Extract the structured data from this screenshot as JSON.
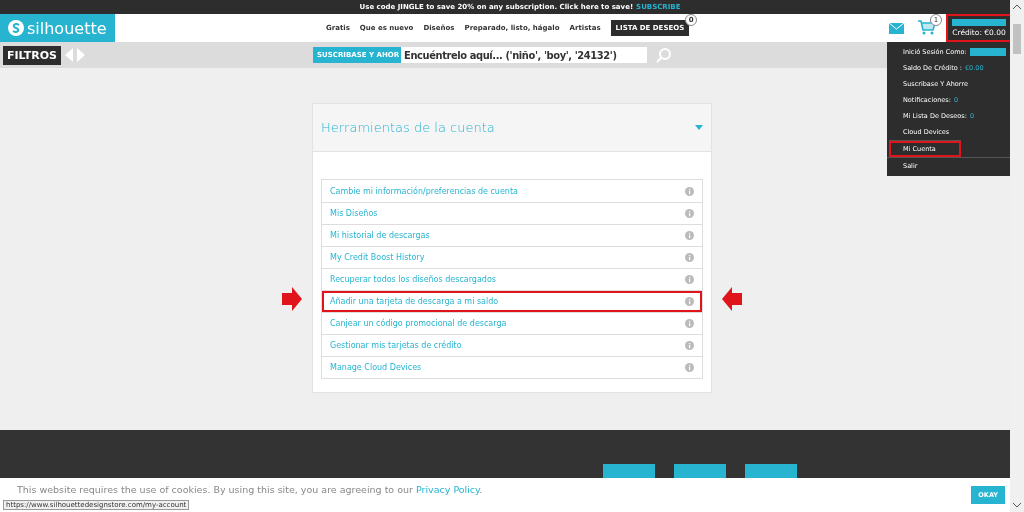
{
  "promo_banner": {
    "text": "Use code JINGLE to save 20% on any subscription. Click here to save!",
    "link": "SUBSCRIBE"
  },
  "header": {
    "logo": "silhouette",
    "nav": [
      "Gratis",
      "Que es nuevo",
      "Diseños",
      "Preparado, listo, hágalo",
      "Artistas"
    ],
    "wishlist": {
      "label": "LISTA DE DESEOS",
      "count": "0"
    },
    "cart_count": "1",
    "credit": {
      "label": "Crédito: €0.00",
      "highlighted": true
    }
  },
  "filter_bar": {
    "filters_label": "FILTROS",
    "subscribe_button": "SUSCRIBASE Y AHOR",
    "search": {
      "placeholder": "Encuéntrelo aquí... ('niño', 'boy', '24132')"
    }
  },
  "account_menu": {
    "items": [
      {
        "label": "Inició Sesión Como:",
        "kind": "redacted",
        "highlighted": false
      },
      {
        "label": "Saldo De Crédito :",
        "value": "€0.00",
        "kind": "boost",
        "highlighted": false
      },
      {
        "label": "Suscribase Y Ahorre",
        "kind": "plain",
        "highlighted": false
      },
      {
        "label": "Notificaciones:",
        "value": "0",
        "kind": "value",
        "highlighted": false
      },
      {
        "label": "Mi Lista De Deseos:",
        "value": "0",
        "kind": "value",
        "highlighted": false
      },
      {
        "label": "Cloud Devices",
        "kind": "plain",
        "highlighted": false
      },
      {
        "label": "Mi Cuenta",
        "kind": "divided",
        "highlighted": true
      },
      {
        "label": "Salir",
        "kind": "divided",
        "highlighted": false
      }
    ]
  },
  "account_tools": {
    "title": "Herramientas de la cuenta",
    "expanded": true,
    "items": [
      {
        "label": "Cambie mi información/preferencias de cuenta",
        "highlighted": false
      },
      {
        "label": "Mis Diseños",
        "highlighted": false
      },
      {
        "label": "Mi historial de descargas",
        "highlighted": false
      },
      {
        "label": "My Credit Boost History",
        "highlighted": false
      },
      {
        "label": "Recuperar todos los diseños descargados",
        "highlighted": false
      },
      {
        "label": "Añadir una tarjeta de descarga a mi saldo",
        "highlighted": true
      },
      {
        "label": "Canjear un código promocional de descarga",
        "highlighted": false
      },
      {
        "label": "Gestionar mis tarjetas de crédito",
        "highlighted": false
      },
      {
        "label": "Manage Cloud Devices",
        "highlighted": false
      }
    ]
  },
  "cookie_bar": {
    "text": "This website requires the use of cookies. By using this site, you are agreeing to our ",
    "link": "Privacy Policy",
    "after": ".",
    "button": "OKAY"
  },
  "status_url": "https://www.silhouettedesignstore.com/my-account"
}
